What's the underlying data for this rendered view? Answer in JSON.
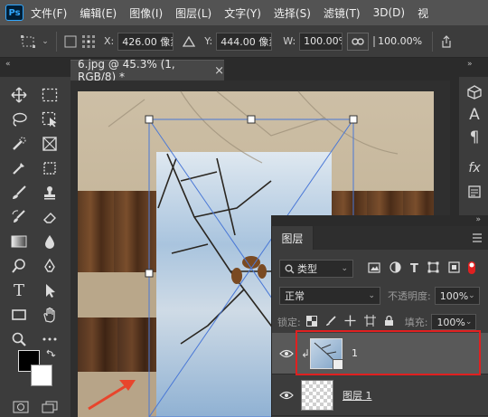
{
  "menu": [
    "文件(F)",
    "编辑(E)",
    "图像(I)",
    "图层(L)",
    "文字(Y)",
    "选择(S)",
    "滤镜(T)",
    "3D(D)",
    "视"
  ],
  "app_logo": "Ps",
  "options": {
    "x_label": "X:",
    "x_value": "426.00 像素",
    "y_label": "Y:",
    "y_value": "444.00 像素",
    "w_label": "W:",
    "w_value": "100.00%",
    "h_value": "100.00%",
    "h_label": "H:"
  },
  "gutter_left": "«",
  "gutter_mid": "»",
  "document_tab": {
    "title": "6.jpg @ 45.3% (1, RGB/8) *",
    "close": "×"
  },
  "layers_panel": {
    "tab": "图层",
    "kind_filter": "类型",
    "blend_mode": "正常",
    "opacity_label": "不透明度:",
    "opacity_value": "100%",
    "lock_label": "锁定:",
    "fill_label": "填充:",
    "fill_value": "100%",
    "layers": [
      {
        "name": "1",
        "selected": true
      },
      {
        "name": "图层 1",
        "selected": false
      }
    ]
  },
  "colors": {
    "accent_highlight": "#e02020",
    "transform_box": "#4a78d6",
    "arrow": "#e8452c"
  }
}
